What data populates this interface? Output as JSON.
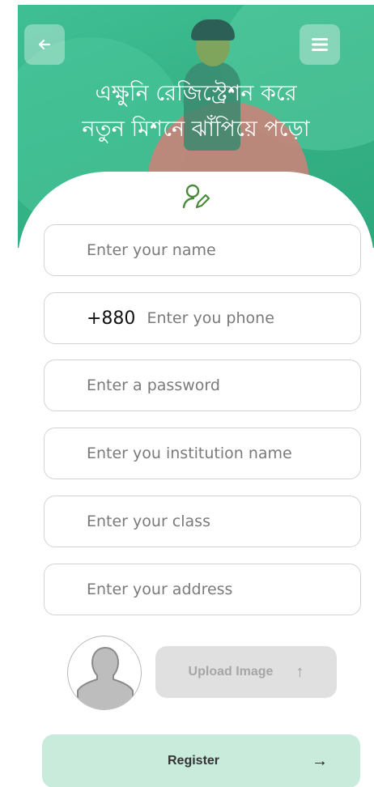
{
  "header": {
    "headline_line1": "এক্ষুনি রেজিস্ট্রেশন করে",
    "headline_line2": "নতুন মিশনে ঝাঁপিয়ে পড়ো",
    "back_icon": "arrow-left-icon",
    "menu_icon": "hamburger-menu-icon",
    "colors": {
      "primary": "#36b387",
      "accent_circle": "#c9837a"
    }
  },
  "form": {
    "name": {
      "placeholder": "Enter your name",
      "value": ""
    },
    "phone": {
      "prefix": "+880",
      "placeholder": "Enter you phone",
      "value": ""
    },
    "password": {
      "placeholder": "Enter a password",
      "value": ""
    },
    "institution": {
      "placeholder": "Enter you institution name",
      "value": ""
    },
    "class": {
      "placeholder": "Enter your class",
      "value": ""
    },
    "address": {
      "placeholder": "Enter your address",
      "value": ""
    }
  },
  "upload": {
    "label": "Upload Image",
    "icon": "arrow-up-icon"
  },
  "register": {
    "label": "Register",
    "icon": "arrow-right-icon",
    "color": "#c9ebdb"
  }
}
